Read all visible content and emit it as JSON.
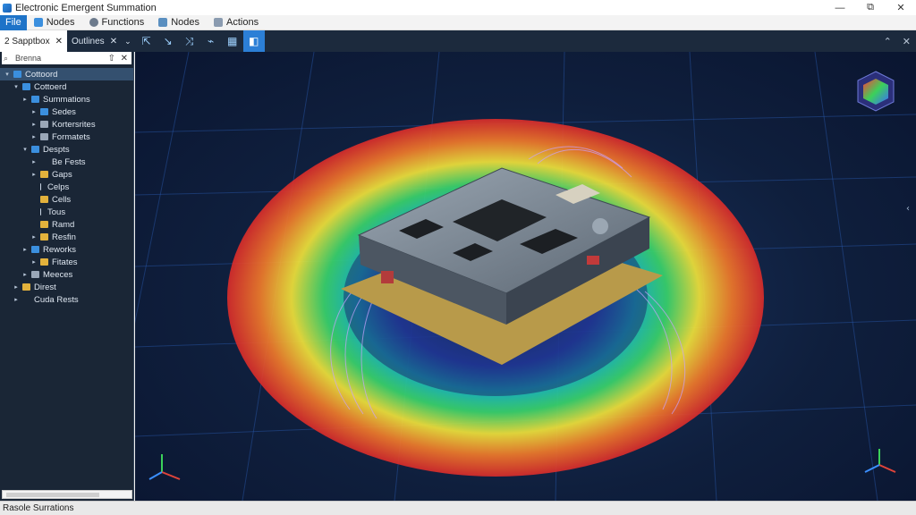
{
  "window": {
    "title": "Electronic Emergent Summation",
    "controls": {
      "minimize": "—",
      "maximize": "⧉",
      "close": "✕"
    }
  },
  "menu": {
    "file": "File",
    "items": [
      {
        "label": "Nodes",
        "icon": "nodes-icon",
        "color": "#3b8fde"
      },
      {
        "label": "Functions",
        "icon": "functions-icon",
        "color": "#6c7a8c"
      },
      {
        "label": "Nodes",
        "icon": "nodes-icon",
        "color": "#5a8fc0"
      },
      {
        "label": "Actions",
        "icon": "actions-icon",
        "color": "#8a9bb0"
      }
    ]
  },
  "toolbar": {
    "tabs": [
      {
        "label": "2 Sapptbox",
        "close": "✕"
      },
      {
        "label": "Outlines",
        "close": "✕",
        "chevron": "⌄"
      }
    ],
    "tools": [
      {
        "name": "select-tool",
        "glyph": "⇱"
      },
      {
        "name": "probe-tool",
        "glyph": "↘"
      },
      {
        "name": "field-tool",
        "glyph": "⤨"
      },
      {
        "name": "wire-tool",
        "glyph": "⌁"
      },
      {
        "name": "component-tool",
        "glyph": "▦"
      },
      {
        "name": "package-tool",
        "glyph": "◧"
      }
    ],
    "right": {
      "pin": "⌃",
      "close": "✕"
    }
  },
  "sidebar": {
    "search_text": "Brenna",
    "pin_glyph": "⇧",
    "close_glyph": "✕",
    "tree": [
      {
        "label": "Cottoord",
        "indent": 0,
        "twisty": "▾",
        "icon": "blue",
        "selected": true
      },
      {
        "label": "Cottoerd",
        "indent": 1,
        "twisty": "▾",
        "icon": "blue"
      },
      {
        "label": "Summations",
        "indent": 2,
        "twisty": "▸",
        "icon": "blue"
      },
      {
        "label": "Sedes",
        "indent": 3,
        "twisty": "▸",
        "icon": "blue"
      },
      {
        "label": "Kortersrites",
        "indent": 3,
        "twisty": "▸",
        "icon": "gray"
      },
      {
        "label": "Formatets",
        "indent": 3,
        "twisty": "▸",
        "icon": "gray"
      },
      {
        "label": "Despts",
        "indent": 2,
        "twisty": "▾",
        "icon": "blue"
      },
      {
        "label": "Be Fests",
        "indent": 3,
        "twisty": "▸",
        "icon": ""
      },
      {
        "label": "Gaps",
        "indent": 3,
        "twisty": "▸",
        "icon": "yellow"
      },
      {
        "label": "Celps",
        "indent": 3,
        "twisty": "",
        "icon": "doc"
      },
      {
        "label": "Cells",
        "indent": 3,
        "twisty": "",
        "icon": "yellow"
      },
      {
        "label": "Tous",
        "indent": 3,
        "twisty": "",
        "icon": "doc"
      },
      {
        "label": "Ramd",
        "indent": 3,
        "twisty": "",
        "icon": "yellow"
      },
      {
        "label": "Resfin",
        "indent": 3,
        "twisty": "▸",
        "icon": "yellow"
      },
      {
        "label": "Reworks",
        "indent": 2,
        "twisty": "▸",
        "icon": "blue"
      },
      {
        "label": "Fitates",
        "indent": 3,
        "twisty": "▸",
        "icon": "yellow"
      },
      {
        "label": "Meeces",
        "indent": 2,
        "twisty": "▸",
        "icon": "gray"
      },
      {
        "label": "Direst",
        "indent": 1,
        "twisty": "▸",
        "icon": "yellow"
      },
      {
        "label": "Cuda Rests",
        "indent": 1,
        "twisty": "▸",
        "icon": ""
      }
    ]
  },
  "status": {
    "text": "Rasole Surrations"
  },
  "colors": {
    "accent": "#2c7fd6",
    "viewport_bg": "#0f1f3d",
    "grid": "#2a5bb0"
  }
}
